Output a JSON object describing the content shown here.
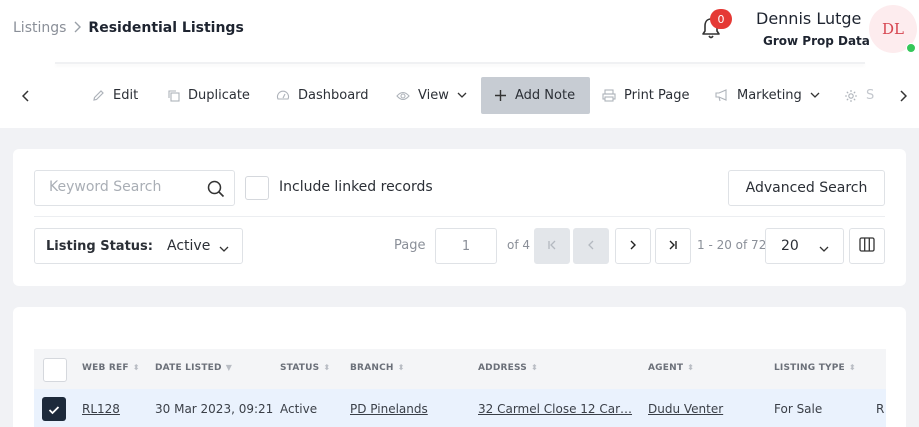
{
  "breadcrumb": {
    "root": "Listings",
    "separator": ">",
    "current": "Residential Listings"
  },
  "notifications": {
    "count": "0"
  },
  "user": {
    "name": "Dennis Lutge",
    "company": "Grow Prop Data",
    "initials": "DL"
  },
  "toolbar": {
    "items": [
      {
        "label": "Edit",
        "icon": "pencil-icon"
      },
      {
        "label": "Duplicate",
        "icon": "copy-icon"
      },
      {
        "label": "Dashboard",
        "icon": "dashboard-icon"
      },
      {
        "label": "View",
        "icon": "eye-icon"
      },
      {
        "label": "Add Note",
        "icon": "plus-icon"
      },
      {
        "label": "Print Page",
        "icon": "printer-icon"
      },
      {
        "label": "Marketing",
        "icon": "megaphone-icon"
      },
      {
        "label": "S",
        "icon": "gear-icon"
      }
    ]
  },
  "search": {
    "placeholder": "Keyword Search",
    "include_linked_label": "Include linked records",
    "advanced_label": "Advanced Search"
  },
  "filter": {
    "status_label": "Listing Status:",
    "status_value": "Active"
  },
  "pagination": {
    "page_label": "Page",
    "current_page": "1",
    "of_label": "of 4",
    "range_label": "1 - 20 of 72",
    "page_size": "20"
  },
  "table": {
    "columns": [
      "WEB REF",
      "DATE LISTED",
      "STATUS",
      "BRANCH",
      "ADDRESS",
      "AGENT",
      "LISTING TYPE"
    ],
    "rows": [
      {
        "web_ref": "RL128",
        "date_listed": "30 Mar 2023, 09:21",
        "status": "Active",
        "branch": "PD Pinelands",
        "address": "32 Carmel Close 12 Car…",
        "agent": "Dudu Venter",
        "listing_type": "For Sale",
        "extra": "R"
      }
    ]
  },
  "colors": {
    "accent_active": "#c7ccd3",
    "badge": "#e53935",
    "online": "#34c759",
    "checked": "#1d2a3b",
    "row_selected": "#eaf2fd"
  }
}
